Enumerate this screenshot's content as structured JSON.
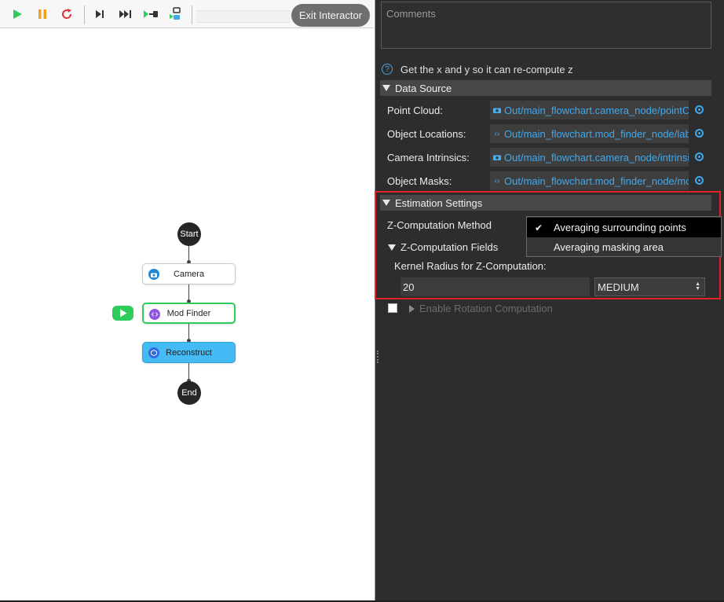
{
  "toolbar": {
    "exit_label": "Exit Interactor"
  },
  "flowchart": {
    "start_label": "Start",
    "end_label": "End",
    "nodes": [
      {
        "label": "Camera",
        "icon": "camera-icon"
      },
      {
        "label": "Mod Finder",
        "icon": "code-icon"
      },
      {
        "label": "Reconstruct",
        "icon": "cube-icon"
      }
    ]
  },
  "panel": {
    "comments_placeholder": "Comments",
    "help_text": "Get the x and y so it can re-compute z",
    "data_source": {
      "header": "Data Source",
      "rows": [
        {
          "label": "Point Cloud:",
          "value": "Out/main_flowchart.camera_node/pointC",
          "icon": "camera-icon"
        },
        {
          "label": "Object Locations:",
          "value": "Out/main_flowchart.mod_finder_node/lab",
          "icon": "code-icon"
        },
        {
          "label": "Camera Intrinsics:",
          "value": "Out/main_flowchart.camera_node/intrinsi",
          "icon": "camera-icon"
        },
        {
          "label": "Object Masks:",
          "value": "Out/main_flowchart.mod_finder_node/mo",
          "icon": "code-icon"
        }
      ]
    },
    "estimation": {
      "header": "Estimation Settings",
      "z_method_label": "Z-Computation Method",
      "z_fields_label": "Z-Computation Fields",
      "kernel_label": "Kernel Radius for Z-Computation:",
      "kernel_value": "20",
      "kernel_size_select": "MEDIUM",
      "dropdown_options": [
        "Averaging surrounding points",
        "Averaging masking area"
      ],
      "dropdown_selected_index": 0
    },
    "rotation_label": "Enable Rotation Computation"
  },
  "colors": {
    "accent_blue": "#3fa9f0",
    "highlight_red": "#e0202a",
    "run_green": "#2ecc5a",
    "node_active_green": "#2ecc5a",
    "node_selected_blue": "#45baf5"
  }
}
